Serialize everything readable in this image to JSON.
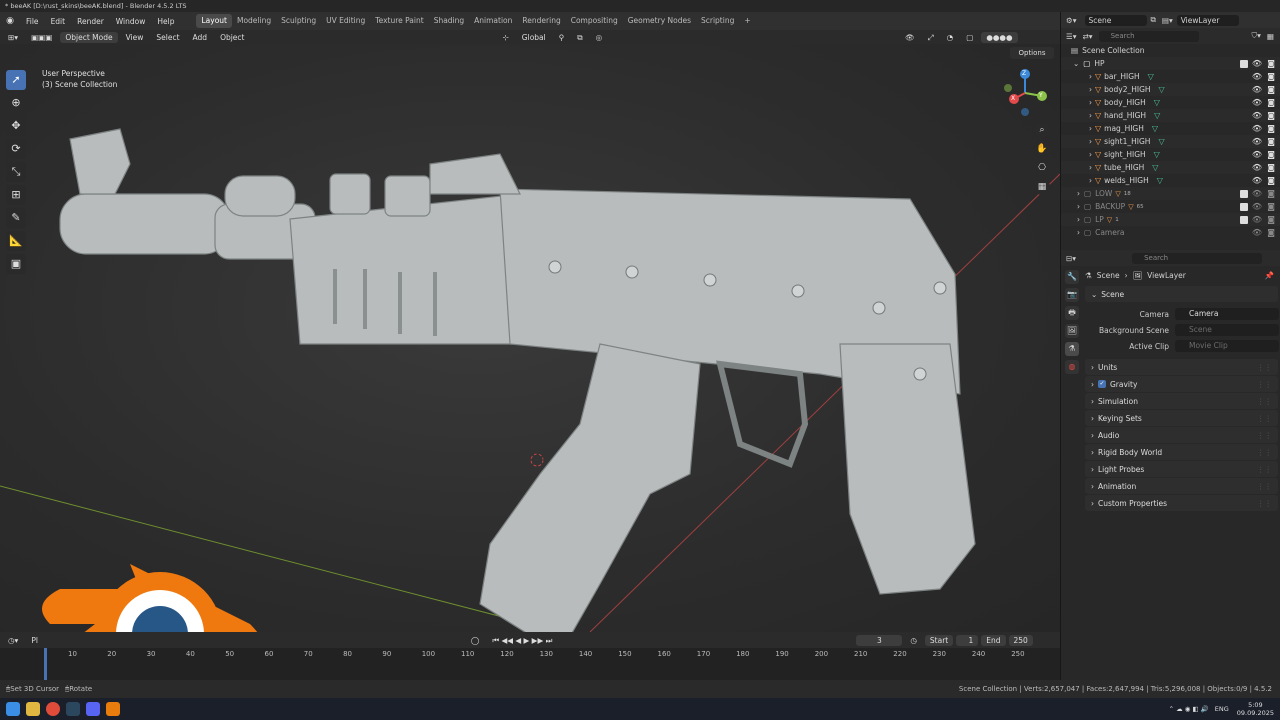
{
  "window": {
    "title": "* beeAK [D:\\rust_skins\\beeAK.blend] - Blender 4.5.2 LTS"
  },
  "menu": [
    "File",
    "Edit",
    "Render",
    "Window",
    "Help"
  ],
  "workspaces": [
    {
      "label": "Layout",
      "active": true
    },
    {
      "label": "Modeling"
    },
    {
      "label": "Sculpting"
    },
    {
      "label": "UV Editing"
    },
    {
      "label": "Texture Paint"
    },
    {
      "label": "Shading"
    },
    {
      "label": "Animation"
    },
    {
      "label": "Rendering"
    },
    {
      "label": "Compositing"
    },
    {
      "label": "Geometry Nodes"
    },
    {
      "label": "Scripting"
    }
  ],
  "top_right": {
    "scene": "Scene",
    "view_layer": "ViewLayer"
  },
  "viewport_header": {
    "mode": "Object Mode",
    "menus": [
      "View",
      "Select",
      "Add",
      "Object"
    ],
    "orientation": "Global",
    "options": "Options"
  },
  "viewport": {
    "perspective": "User Perspective",
    "collection": "(3) Scene Collection"
  },
  "gizmo": {
    "x": "X",
    "y": "Y",
    "z": "Z"
  },
  "outliner": {
    "search_placeholder": "Search",
    "root": "Scene Collection",
    "collection": "HP",
    "objects": [
      "bar_HIGH",
      "body2_HIGH",
      "body_HIGH",
      "hand_HIGH",
      "mag_HIGH",
      "sight1_HIGH",
      "sight_HIGH",
      "tube_HIGH",
      "welds_HIGH"
    ],
    "other_collections": [
      "LOW",
      "BACKUP",
      "LP",
      "Camera"
    ],
    "badges": {
      "LOW": "18",
      "BACKUP": "65",
      "LP": "1"
    }
  },
  "properties": {
    "search_placeholder": "Search",
    "breadcrumb": [
      "Scene",
      "ViewLayer"
    ],
    "section": "Scene",
    "fields": [
      {
        "label": "Camera",
        "value": "Camera",
        "empty": false
      },
      {
        "label": "Background Scene",
        "value": "Scene",
        "empty": true
      },
      {
        "label": "Active Clip",
        "value": "Movie Clip",
        "empty": true
      }
    ],
    "panels": [
      "Units",
      "Gravity",
      "Simulation",
      "Keying Sets",
      "Audio",
      "Rigid Body World",
      "Light Probes",
      "Animation",
      "Custom Properties"
    ],
    "gravity_checked": true
  },
  "timeline": {
    "playback": "Pl",
    "current_frame": "3",
    "start_label": "Start",
    "start": "1",
    "end_label": "End",
    "end": "250",
    "ticks": [
      "10",
      "20",
      "30",
      "40",
      "50",
      "60",
      "70",
      "80",
      "90",
      "100",
      "110",
      "120",
      "130",
      "140",
      "150",
      "160",
      "170",
      "180",
      "190",
      "200",
      "210",
      "220",
      "230",
      "240",
      "250"
    ]
  },
  "status": {
    "left1": "Set 3D Cursor",
    "left2": "Rotate",
    "stats": "Scene Collection | Verts:2,657,047 | Faces:2,647,994 | Tris:5,296,008 | Objects:0/9 | 4.5.2"
  },
  "taskbar": {
    "lang": "ENG",
    "time": "5:09",
    "date": "09.09.2025"
  },
  "colors": {
    "accent": "#4772b3",
    "object_orange": "#ffa14e",
    "mesh_green": "#4ec19a",
    "blender_orange": "#f0790f",
    "blender_blue": "#265787"
  }
}
